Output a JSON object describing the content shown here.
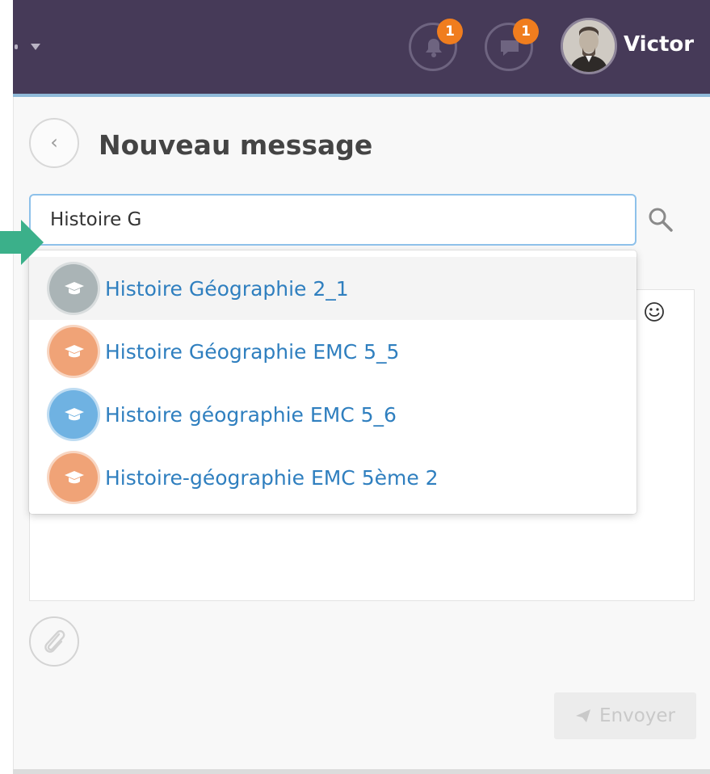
{
  "header": {
    "notifications_count": "1",
    "messages_count": "1",
    "user_name": "Victor",
    "background_color": "#463a58",
    "badge_color": "#f07d1e"
  },
  "compose": {
    "title": "Nouveau message",
    "recipient_query": "Histoire G",
    "send_label": "Envoyer"
  },
  "suggestions": [
    {
      "label": "Histoire Géographie 2_1",
      "avatar_color": "#aab4b6",
      "icon": "graduation-cap-icon"
    },
    {
      "label": "Histoire Géographie EMC 5_5",
      "avatar_color": "#f0a377",
      "icon": "graduation-cap-icon"
    },
    {
      "label": "Histoire géographie EMC 5_6",
      "avatar_color": "#6fb2e2",
      "icon": "graduation-cap-icon"
    },
    {
      "label": "Histoire-géographie EMC 5ème 2",
      "avatar_color": "#f0a377",
      "icon": "graduation-cap-icon"
    }
  ],
  "colors": {
    "link": "#2f7fbf",
    "accent_arrow": "#3bb08a"
  }
}
